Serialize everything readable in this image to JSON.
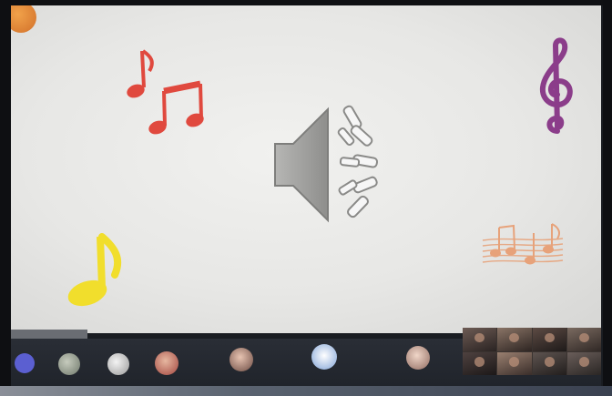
{
  "slide": {
    "speaker_icon": "speaker-sound-icon",
    "notes": [
      {
        "name": "red-sixteenth-note-icon",
        "color": "#e0493e"
      },
      {
        "name": "red-beamed-eighth-notes-icon",
        "color": "#e0493e"
      },
      {
        "name": "purple-treble-clef-icon",
        "color": "#8b3d8a"
      },
      {
        "name": "yellow-eighth-note-icon",
        "color": "#f1de2c"
      },
      {
        "name": "orange-staff-notes-icon",
        "color": "#e7a27a"
      }
    ]
  },
  "presenter_chip": {
    "label": ""
  },
  "participants": [
    {
      "type": "avatar",
      "initials": "",
      "color": "#5b5fd1"
    },
    {
      "type": "photo",
      "color": "#9fa898"
    },
    {
      "type": "photo",
      "color": "#c9c9c9"
    },
    {
      "type": "photo",
      "color": "#c8655d"
    },
    {
      "type": "photo",
      "name": "",
      "color": "#b07a6a"
    },
    {
      "type": "photo",
      "name": "",
      "color": "#f2f2f2"
    },
    {
      "type": "photo",
      "name": "",
      "color": "#c7a59a"
    }
  ],
  "colors": {
    "slide_bg": "#e9e9e7",
    "strip_bg": "#252931",
    "speaker_gray": "#9a9a98"
  }
}
